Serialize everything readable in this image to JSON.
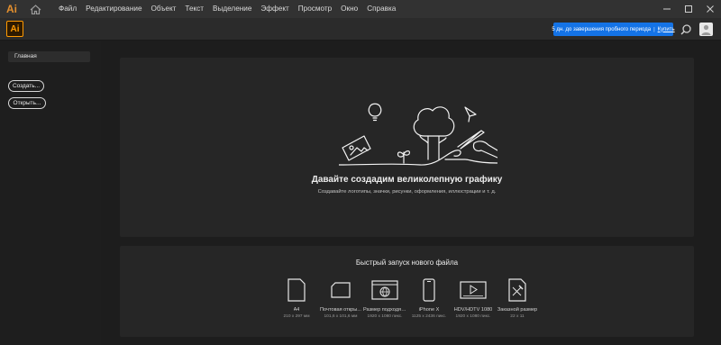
{
  "menubar": {
    "logo": "Ai",
    "items": [
      "Файл",
      "Редактирование",
      "Объект",
      "Текст",
      "Выделение",
      "Эффект",
      "Просмотр",
      "Окно",
      "Справка"
    ]
  },
  "topbar": {
    "app_badge": "Ai",
    "trial_text": "5 дн. до завершения пробного периода",
    "buy_label": "Купить"
  },
  "sidebar": {
    "home_label": "Главная",
    "create_label": "Создать...",
    "open_label": "Открыть..."
  },
  "hero": {
    "title": "Давайте создадим великолепную графику",
    "subtitle": "Создавайте логотипы, значки, рисунки, оформления, иллюстрации и т. д."
  },
  "quick_start": {
    "title": "Быстрый запуск нового файла",
    "presets": [
      {
        "name": "A4",
        "size": "210 x 297 мм",
        "icon": "document-icon"
      },
      {
        "name": "Почтовая откры...",
        "size": "101,6 x 101,6 мм",
        "icon": "postcard-icon"
      },
      {
        "name": "Размер подходящ...",
        "size": "1920 x 1080 пикс.",
        "icon": "web-icon"
      },
      {
        "name": "iPhone X",
        "size": "1125 x 2436 пикс.",
        "icon": "phone-icon"
      },
      {
        "name": "HDV/HDTV 1080",
        "size": "1920 x 1080 пикс.",
        "icon": "video-icon"
      },
      {
        "name": "Заказной размер",
        "size": "22 x 11",
        "icon": "custom-size-icon"
      }
    ]
  },
  "colors": {
    "accent": "#1473e6",
    "brand": "#ff9a00",
    "panel": "#262626",
    "background": "#1d1d1d"
  }
}
